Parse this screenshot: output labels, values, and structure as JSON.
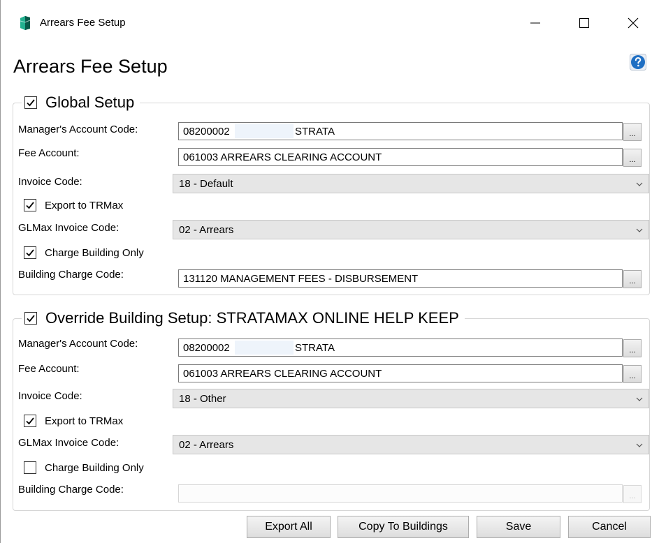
{
  "window": {
    "title": "Arrears Fee Setup"
  },
  "page": {
    "title": "Arrears Fee Setup"
  },
  "icons": {
    "app": "database-icon",
    "help": "question-mark-icon",
    "accent": "#1f6fc3"
  },
  "global": {
    "legend": "Global Setup",
    "checked": true,
    "manager_label": "Manager's Account Code:",
    "manager_code": "08200002",
    "manager_name": "STRATA",
    "fee_label": "Fee Account:",
    "fee_value": "061003 ARREARS CLEARING ACCOUNT",
    "invoice_label": "Invoice Code:",
    "invoice_value": "18 - Default",
    "export_label": "Export to TRMax",
    "export_checked": true,
    "glmax_label": "GLMax Invoice Code:",
    "glmax_value": "02 - Arrears",
    "charge_label": "Charge Building Only",
    "charge_checked": true,
    "building_label": "Building Charge Code:",
    "building_value": "131120 MANAGEMENT FEES - DISBURSEMENT",
    "lookup_label": "..."
  },
  "override": {
    "legend": "Override Building Setup:  STRATAMAX ONLINE HELP KEEP",
    "checked": true,
    "manager_label": "Manager's Account Code:",
    "manager_code": "08200002",
    "manager_name": "STRATA",
    "fee_label": "Fee Account:",
    "fee_value": "061003 ARREARS CLEARING ACCOUNT",
    "invoice_label": "Invoice Code:",
    "invoice_value": "18 - Other",
    "export_label": "Export to TRMax",
    "export_checked": true,
    "glmax_label": "GLMax Invoice Code:",
    "glmax_value": "02 - Arrears",
    "charge_label": "Charge Building Only",
    "charge_checked": false,
    "building_label": "Building Charge Code:",
    "building_value": "",
    "lookup_label": "..."
  },
  "buttons": {
    "export_all": "Export All",
    "copy_to_buildings": "Copy To Buildings",
    "save": "Save",
    "cancel": "Cancel"
  }
}
